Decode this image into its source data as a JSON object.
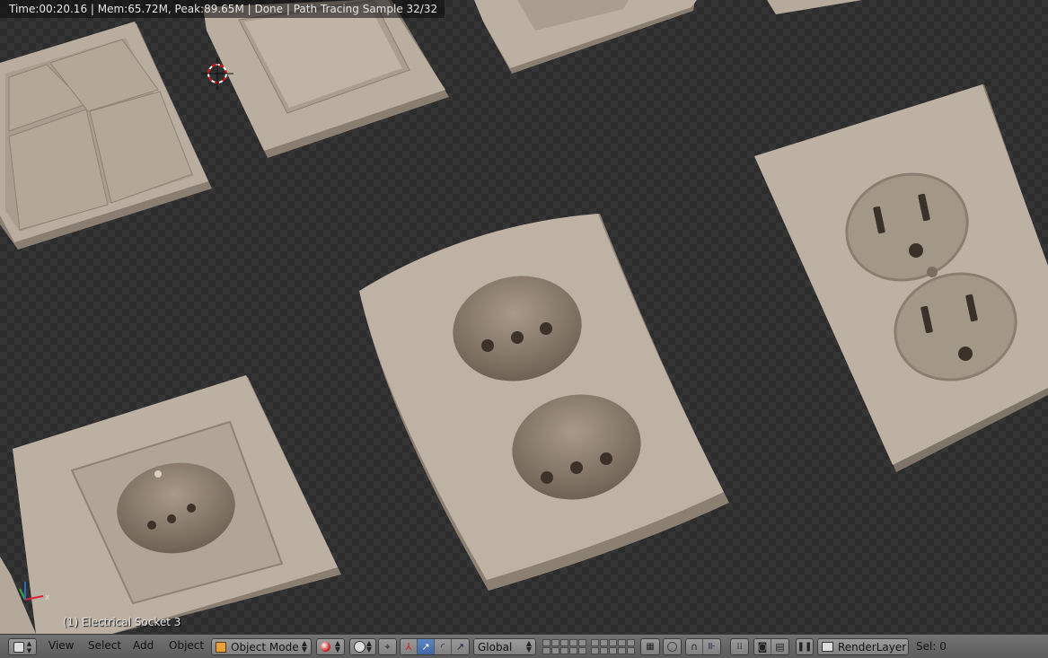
{
  "viewport": {
    "render_info": "Time:00:20.16 | Mem:65.72M, Peak:89.65M | Done | Path Tracing Sample 32/32",
    "object_info": "(1) Electrical Socket 3"
  },
  "header": {
    "editor_type_icon": "3d-view-icon",
    "menu": [
      "View",
      "Select",
      "Add",
      "Object"
    ],
    "mode": "Object Mode",
    "transform_orientation": "Global",
    "render_layer": "RenderLayer",
    "selection_count": "Sel: 0"
  },
  "colors": {
    "accent": "#5680c2",
    "plate": "#b6aa9c",
    "header": "#6a6a6a"
  }
}
